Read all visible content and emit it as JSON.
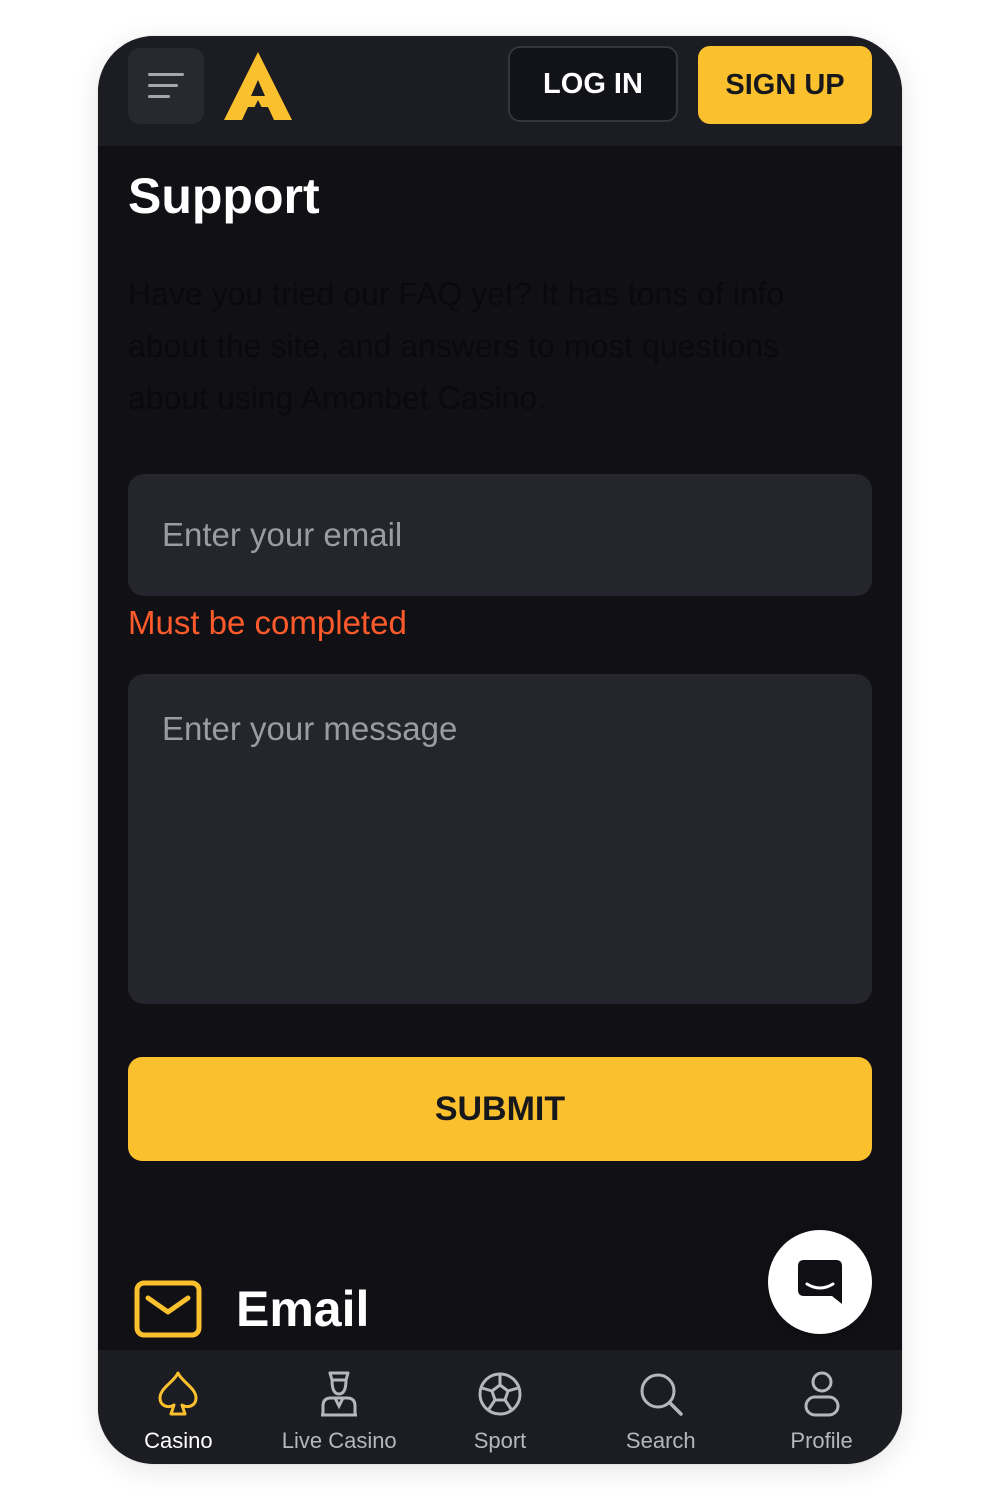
{
  "header": {
    "login_label": "LOG IN",
    "signup_label": "SIGN UP",
    "menu_icon": "hamburger-menu-icon",
    "logo_icon": "brand-a-logo"
  },
  "main": {
    "title": "Support",
    "faq_text": "Have you tried our FAQ yet? It has tons of info about the site, and answers to most questions about using Amonbet Casino.",
    "email_placeholder": "Enter your email",
    "email_value": "",
    "email_error": "Must be completed",
    "message_placeholder": "Enter your message",
    "message_value": "",
    "submit_label": "SUBMIT",
    "contact_heading": "Email",
    "contact_icon": "envelope-icon"
  },
  "chat": {
    "icon": "chat-bubble-icon"
  },
  "nav": {
    "items": [
      {
        "label": "Casino",
        "icon": "spade-icon",
        "active": true
      },
      {
        "label": "Live Casino",
        "icon": "dealer-icon",
        "active": false
      },
      {
        "label": "Sport",
        "icon": "soccer-ball-icon",
        "active": false
      },
      {
        "label": "Search",
        "icon": "search-icon",
        "active": false
      },
      {
        "label": "Profile",
        "icon": "user-icon",
        "active": false
      }
    ]
  },
  "colors": {
    "accent": "#fbc02d",
    "background": "#111115",
    "surface": "#24252d",
    "header": "#1c1d23",
    "error": "#ff5a2b"
  }
}
